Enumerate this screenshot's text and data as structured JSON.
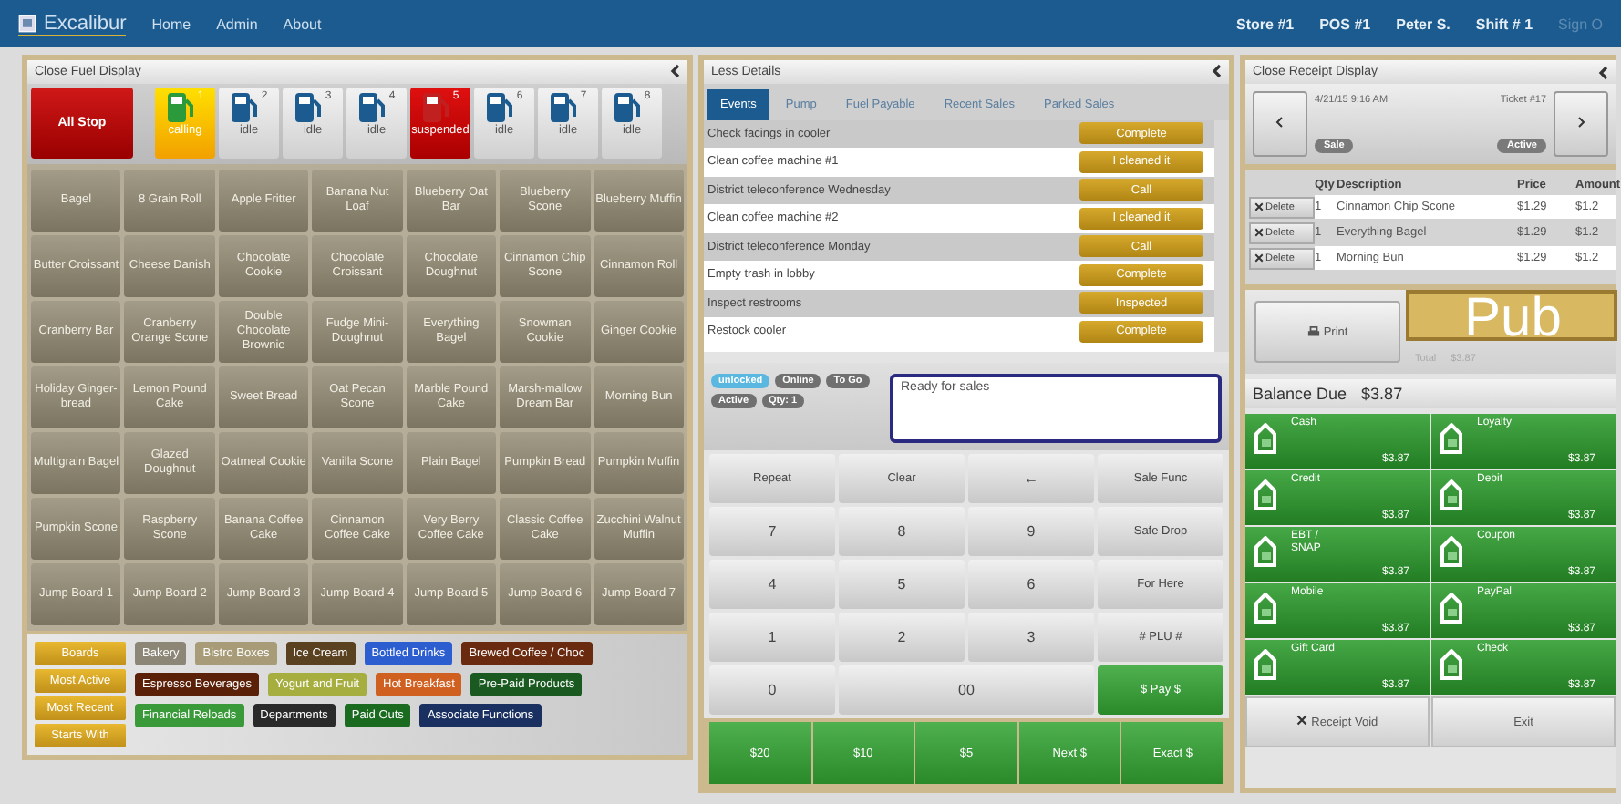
{
  "nav": {
    "brand": "Excalibur",
    "links": [
      "Home",
      "Admin",
      "About"
    ],
    "status": [
      "Store #1",
      "POS #1",
      "Peter S.",
      "Shift # 1"
    ],
    "sign_out": "Sign O"
  },
  "fuel": {
    "title": "Close Fuel Display",
    "all_stop": "All Stop",
    "pumps": [
      {
        "number": "1",
        "status": "calling",
        "kind": "calling"
      },
      {
        "number": "2",
        "status": "idle",
        "kind": "idle"
      },
      {
        "number": "3",
        "status": "idle",
        "kind": "idle"
      },
      {
        "number": "4",
        "status": "idle",
        "kind": "idle"
      },
      {
        "number": "5",
        "status": "suspended",
        "kind": "suspended"
      },
      {
        "number": "6",
        "status": "idle",
        "kind": "idle"
      },
      {
        "number": "7",
        "status": "idle",
        "kind": "idle"
      },
      {
        "number": "8",
        "status": "idle",
        "kind": "idle"
      }
    ]
  },
  "items": [
    "Bagel",
    "8 Grain Roll",
    "Apple Fritter",
    "Banana Nut Loaf",
    "Blueberry Oat Bar",
    "Blueberry Scone",
    "Blueberry Muffin",
    "Butter Croissant",
    "Cheese Danish",
    "Chocolate Cookie",
    "Chocolate Croissant",
    "Chocolate Doughnut",
    "Cinnamon Chip Scone",
    "Cinnamon Roll",
    "Cranberry Bar",
    "Cranberry Orange Scone",
    "Double Chocolate Brownie",
    "Fudge Mini-Doughnut",
    "Everything Bagel",
    "Snowman Cookie",
    "Ginger Cookie",
    "Holiday Ginger-bread",
    "Lemon Pound Cake",
    "Sweet Bread",
    "Oat Pecan Scone",
    "Marble Pound Cake",
    "Marsh-mallow Dream Bar",
    "Morning Bun",
    "Multigrain Bagel",
    "Glazed Doughnut",
    "Oatmeal Cookie",
    "Vanilla Scone",
    "Plain Bagel",
    "Pumpkin Bread",
    "Pumpkin Muffin",
    "Pumpkin Scone",
    "Raspberry Scone",
    "Banana Coffee Cake",
    "Cinnamon Coffee Cake",
    "Very Berry Coffee Cake",
    "Classic Coffee Cake",
    "Zucchini Walnut Muffin",
    "Jump Board 1",
    "Jump Board 2",
    "Jump Board 3",
    "Jump Board 4",
    "Jump Board 5",
    "Jump Board 6",
    "Jump Board 7"
  ],
  "boards": [
    "Boards",
    "Most Active",
    "Most Recent",
    "Starts With"
  ],
  "departments": [
    {
      "label": "Bakery",
      "color": "#8c8676"
    },
    {
      "label": "Bistro Boxes",
      "color": "#a89c78"
    },
    {
      "label": "Ice Cream",
      "color": "#5a4220"
    },
    {
      "label": "Bottled Drinks",
      "color": "#2c5ed0"
    },
    {
      "label": "Brewed Coffee / Choc",
      "color": "#6a2a10"
    },
    {
      "label": "Espresso Beverages",
      "color": "#5a2008"
    },
    {
      "label": "Yogurt and Fruit",
      "color": "#a6ae40"
    },
    {
      "label": "Hot Breakfast",
      "color": "#d06020"
    },
    {
      "label": "Pre-Paid Products",
      "color": "#1a5a20"
    },
    {
      "label": "Financial Reloads",
      "color": "#3a9a3a"
    },
    {
      "label": "Departments",
      "color": "#2a2a2a"
    },
    {
      "label": "Paid Outs",
      "color": "#1a6a20"
    },
    {
      "label": "Associate Functions",
      "color": "#1a3060"
    }
  ],
  "details": {
    "title": "Less Details",
    "tabs": [
      {
        "label": "Events",
        "selected": true
      },
      {
        "label": "Pump",
        "selected": false
      },
      {
        "label": "Fuel Payable",
        "selected": false
      },
      {
        "label": "Recent Sales",
        "selected": false
      },
      {
        "label": "Parked Sales",
        "selected": false
      }
    ],
    "events": [
      {
        "task": "Check facings in cooler",
        "action": "Complete"
      },
      {
        "task": "Clean coffee machine #1",
        "action": "I cleaned it"
      },
      {
        "task": "District teleconference Wednesday",
        "action": "Call"
      },
      {
        "task": "Clean coffee machine #2",
        "action": "I cleaned it"
      },
      {
        "task": "District teleconference Monday",
        "action": "Call"
      },
      {
        "task": "Empty trash in lobby",
        "action": "Complete"
      },
      {
        "task": "Inspect restrooms",
        "action": "Inspected"
      },
      {
        "task": "Restock cooler",
        "action": "Complete"
      }
    ]
  },
  "flags": [
    {
      "label": "unlocked",
      "color": "#5ab8e0"
    },
    {
      "label": "Online",
      "color": "#707070"
    },
    {
      "label": "To Go",
      "color": "#707070"
    },
    {
      "label": "Active",
      "color": "#707070"
    },
    {
      "label": "Qty: 1",
      "color": "#707070"
    }
  ],
  "message": "Ready for sales",
  "keypad": [
    {
      "label": "Repeat",
      "kind": "func"
    },
    {
      "label": "Clear",
      "kind": "func"
    },
    {
      "label": "←",
      "kind": "digit"
    },
    {
      "label": "Sale Func",
      "kind": "func"
    },
    {
      "label": "7",
      "kind": "digit"
    },
    {
      "label": "8",
      "kind": "digit"
    },
    {
      "label": "9",
      "kind": "digit"
    },
    {
      "label": "Safe Drop",
      "kind": "func"
    },
    {
      "label": "4",
      "kind": "digit"
    },
    {
      "label": "5",
      "kind": "digit"
    },
    {
      "label": "6",
      "kind": "digit"
    },
    {
      "label": "For Here",
      "kind": "func"
    },
    {
      "label": "1",
      "kind": "digit"
    },
    {
      "label": "2",
      "kind": "digit"
    },
    {
      "label": "3",
      "kind": "digit"
    },
    {
      "label": "# PLU #",
      "kind": "func"
    },
    {
      "label": "0",
      "kind": "digit"
    },
    {
      "label": "00",
      "kind": "wide"
    },
    {
      "label": "$ Pay $",
      "kind": "pay"
    }
  ],
  "tenders": [
    "$20",
    "$10",
    "$5",
    "Next $",
    "Exact $"
  ],
  "receipt": {
    "title": "Close Receipt Display",
    "date": "4/21/15 9:16 AM",
    "ticket": "Ticket #17",
    "type": "Sale",
    "state": "Active",
    "columns": [
      "Qty",
      "Description",
      "Price",
      "Amount"
    ],
    "rows": [
      {
        "delete": "Delete",
        "qty": "1",
        "description": "Cinnamon Chip Scone",
        "price": "$1.29",
        "amount": "$1.2"
      },
      {
        "delete": "Delete",
        "qty": "1",
        "description": "Everything Bagel",
        "price": "$1.29",
        "amount": "$1.2"
      },
      {
        "delete": "Delete",
        "qty": "1",
        "description": "Morning Bun",
        "price": "$1.29",
        "amount": "$1.2"
      }
    ],
    "print": "Print",
    "banner": "Pub",
    "total_label": "Total",
    "total": "$3.87",
    "balance_label": "Balance Due",
    "balance": "$3.87",
    "payments": [
      {
        "label": "Cash",
        "amount": "$3.87"
      },
      {
        "label": "Loyalty",
        "amount": "$3.87"
      },
      {
        "label": "Credit",
        "amount": "$3.87"
      },
      {
        "label": "Debit",
        "amount": "$3.87"
      },
      {
        "label": "EBT / SNAP",
        "amount": "$3.87"
      },
      {
        "label": "Coupon",
        "amount": "$3.87"
      },
      {
        "label": "Mobile",
        "amount": "$3.87"
      },
      {
        "label": "PayPal",
        "amount": "$3.87"
      },
      {
        "label": "Gift Card",
        "amount": "$3.87"
      },
      {
        "label": "Check",
        "amount": "$3.87"
      }
    ],
    "void": "Receipt Void",
    "exit": "Exit"
  }
}
